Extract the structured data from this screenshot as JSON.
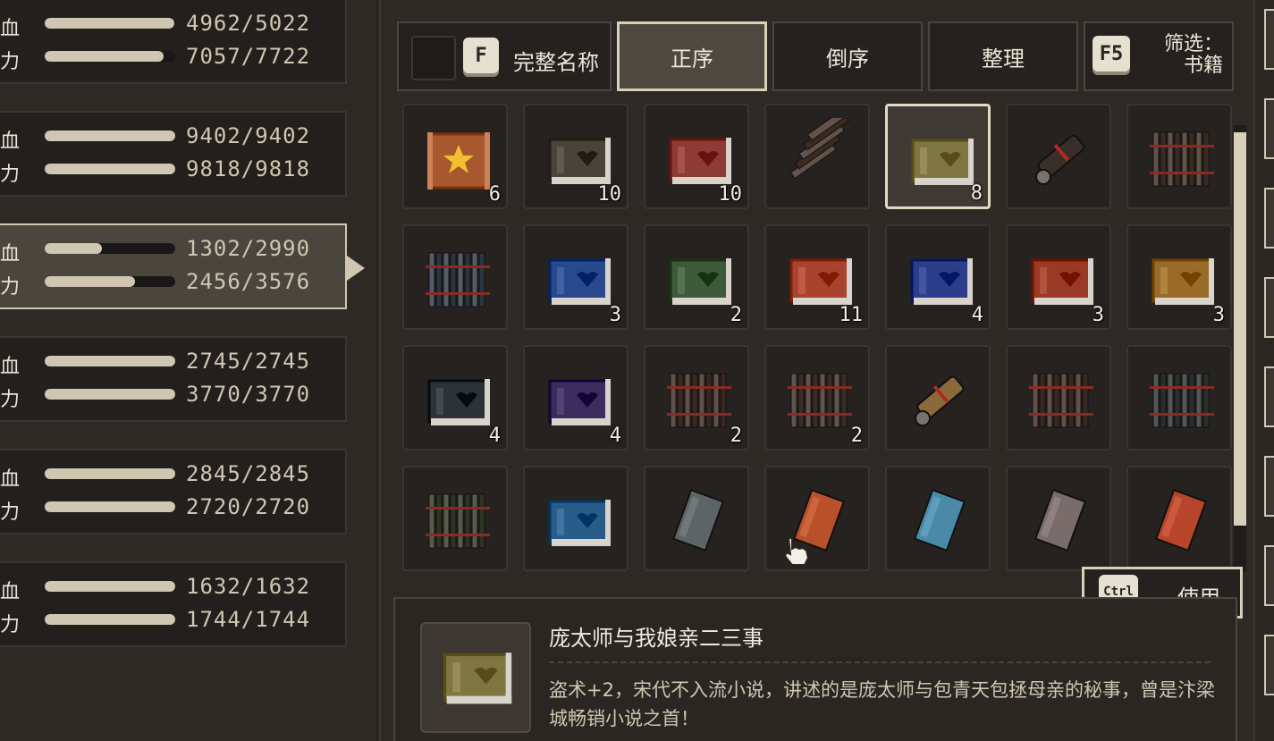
{
  "party": [
    {
      "hp_label": "乏血",
      "hp_text": "4962/5022",
      "hp_frac": 0.99,
      "mp_label": "内力",
      "mp_text": "7057/7722",
      "mp_frac": 0.91,
      "selected": false
    },
    {
      "hp_label": "乏血",
      "hp_text": "9402/9402",
      "hp_frac": 1.0,
      "mp_label": "内力",
      "mp_text": "9818/9818",
      "mp_frac": 1.0,
      "selected": false
    },
    {
      "hp_label": "乏血",
      "hp_text": "1302/2990",
      "hp_frac": 0.44,
      "mp_label": "内力",
      "mp_text": "2456/3576",
      "mp_frac": 0.69,
      "selected": true
    },
    {
      "hp_label": "乏血",
      "hp_text": "2745/2745",
      "hp_frac": 1.0,
      "mp_label": "内力",
      "mp_text": "3770/3770",
      "mp_frac": 1.0,
      "selected": false
    },
    {
      "hp_label": "乏血",
      "hp_text": "2845/2845",
      "hp_frac": 1.0,
      "mp_label": "内力",
      "mp_text": "2720/2720",
      "mp_frac": 1.0,
      "selected": false
    },
    {
      "hp_label": "乏血",
      "hp_text": "1632/1632",
      "hp_frac": 1.0,
      "mp_label": "内力",
      "mp_text": "1744/1744",
      "mp_frac": 1.0,
      "selected": false
    }
  ],
  "toolbar": {
    "fullname_key": "F",
    "fullname_label": "完整名称",
    "asc_label": "正序",
    "desc_label": "倒序",
    "tidy_label": "整理",
    "filter_key": "F5",
    "filter_line1": "筛选：",
    "filter_line2": "书籍"
  },
  "items": [
    {
      "type": "scroll-star",
      "color": "#a8582e",
      "count": "6"
    },
    {
      "type": "book",
      "color": "#4a433b",
      "count": "10"
    },
    {
      "type": "book",
      "color": "#8e3b36",
      "count": "10"
    },
    {
      "type": "bamboo-diag",
      "color": "#3a2a22",
      "count": ""
    },
    {
      "type": "book",
      "color": "#7e7540",
      "count": "8",
      "selected": true
    },
    {
      "type": "scroll-roll",
      "color": "#3a2e28",
      "count": ""
    },
    {
      "type": "bamboo",
      "color": "#3a2a22",
      "count": ""
    },
    {
      "type": "bamboo",
      "color": "#2c3440",
      "count": ""
    },
    {
      "type": "book",
      "color": "#284a8c",
      "count": "3"
    },
    {
      "type": "book",
      "color": "#3e5a3a",
      "count": "2"
    },
    {
      "type": "book",
      "color": "#a8442e",
      "count": "11"
    },
    {
      "type": "book",
      "color": "#2c3e8a",
      "count": "4"
    },
    {
      "type": "book",
      "color": "#9a3a24",
      "count": "3"
    },
    {
      "type": "book",
      "color": "#9a6a28",
      "count": "3"
    },
    {
      "type": "book",
      "color": "#2c3236",
      "count": "4"
    },
    {
      "type": "book",
      "color": "#3a2c5c",
      "count": "4"
    },
    {
      "type": "bamboo",
      "color": "#3a2820",
      "count": "2"
    },
    {
      "type": "bamboo",
      "color": "#3a2c24",
      "count": "2"
    },
    {
      "type": "scroll-roll",
      "color": "#8a6a3a",
      "count": ""
    },
    {
      "type": "bamboo",
      "color": "#3a2820",
      "count": ""
    },
    {
      "type": "bamboo",
      "color": "#2a2e2c",
      "count": ""
    },
    {
      "type": "bamboo",
      "color": "#2e3424",
      "count": ""
    },
    {
      "type": "book",
      "color": "#2a5c8a",
      "count": ""
    },
    {
      "type": "manual",
      "color": "#5c6466",
      "count": ""
    },
    {
      "type": "manual",
      "color": "#b8502a",
      "count": ""
    },
    {
      "type": "manual",
      "color": "#4a8aa8",
      "count": ""
    },
    {
      "type": "manual",
      "color": "#7a6c6a",
      "count": ""
    },
    {
      "type": "manual",
      "color": "#b8442a",
      "count": ""
    }
  ],
  "use_button": {
    "key": "Ctrl",
    "label": "使用"
  },
  "detail": {
    "title": "庞太师与我娘亲二三事",
    "desc": "盗术+2，宋代不入流小说，讲述的是庞太师与包青天包拯母亲的秘事，曾是汴梁城畅销小说之首！",
    "icon_color": "#7e7540"
  }
}
